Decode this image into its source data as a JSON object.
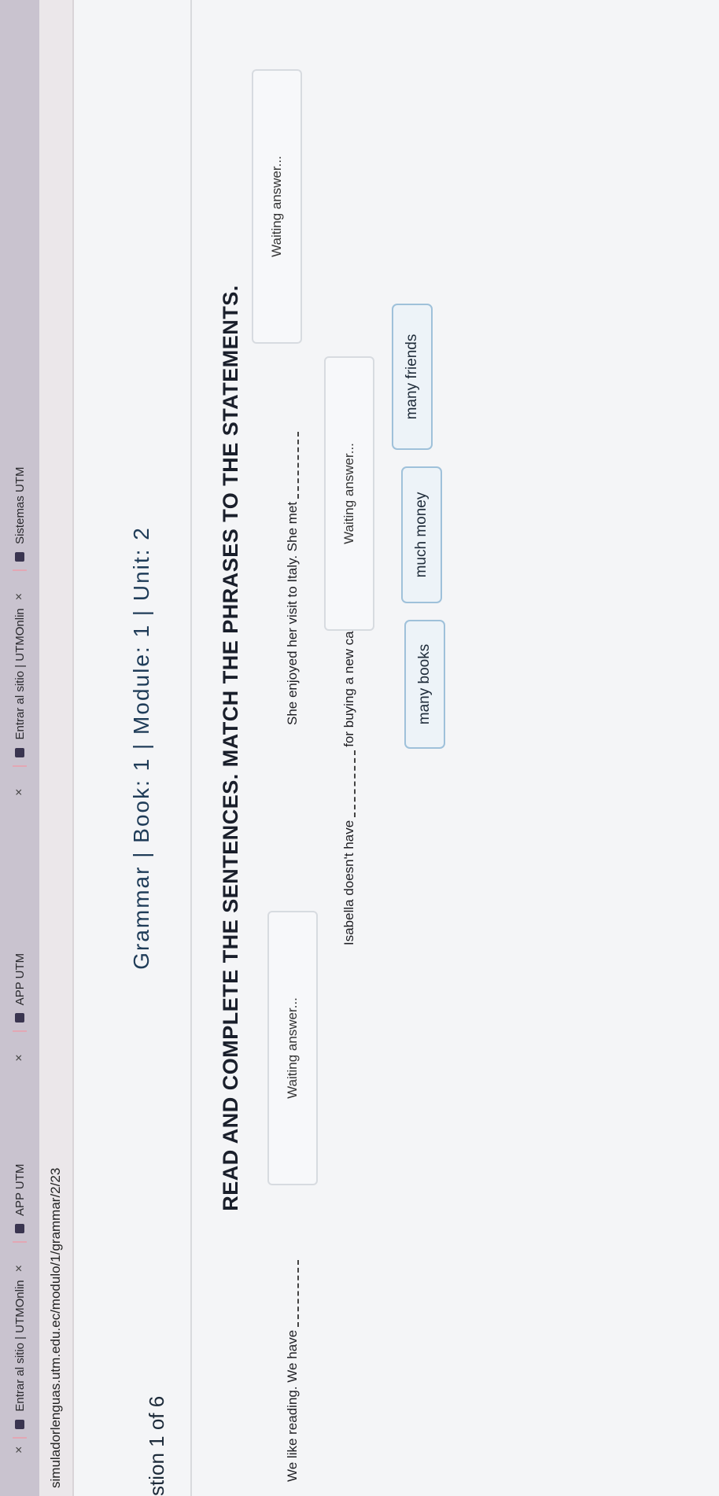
{
  "browser": {
    "tabs": [
      {
        "label": "Entrar al sitio | UTMOnlin"
      },
      {
        "label": "APP UTM"
      },
      {
        "label": "APP UTM"
      },
      {
        "label": "Entrar al sitio | UTMOnlin"
      },
      {
        "label": "Sistemas UTM"
      }
    ],
    "close_glyph": "×",
    "url": "simuladorlenguas.utm.edu.ec/modulo/1/grammar/2/23"
  },
  "quiz": {
    "question_counter": "stion 1 of 6",
    "subject_title": "Grammar | Book: 1 | Module: 1 | Unit: 2",
    "instruction": "READ AND COMPLETE THE SENTENCES. MATCH THE PHRASES TO THE STATEMENTS.",
    "sentences": [
      {
        "before": "We like reading. We have",
        "after": "",
        "answer": "Waiting answer..."
      },
      {
        "before": "She enjoyed her visit to Italy. She met",
        "after": "",
        "answer": "Waiting answer..."
      },
      {
        "before": "Isabella doesn't have",
        "after": "for buying a new car.",
        "answer": "Waiting answer..."
      }
    ],
    "options": [
      "many books",
      "much money",
      "many friends"
    ]
  }
}
